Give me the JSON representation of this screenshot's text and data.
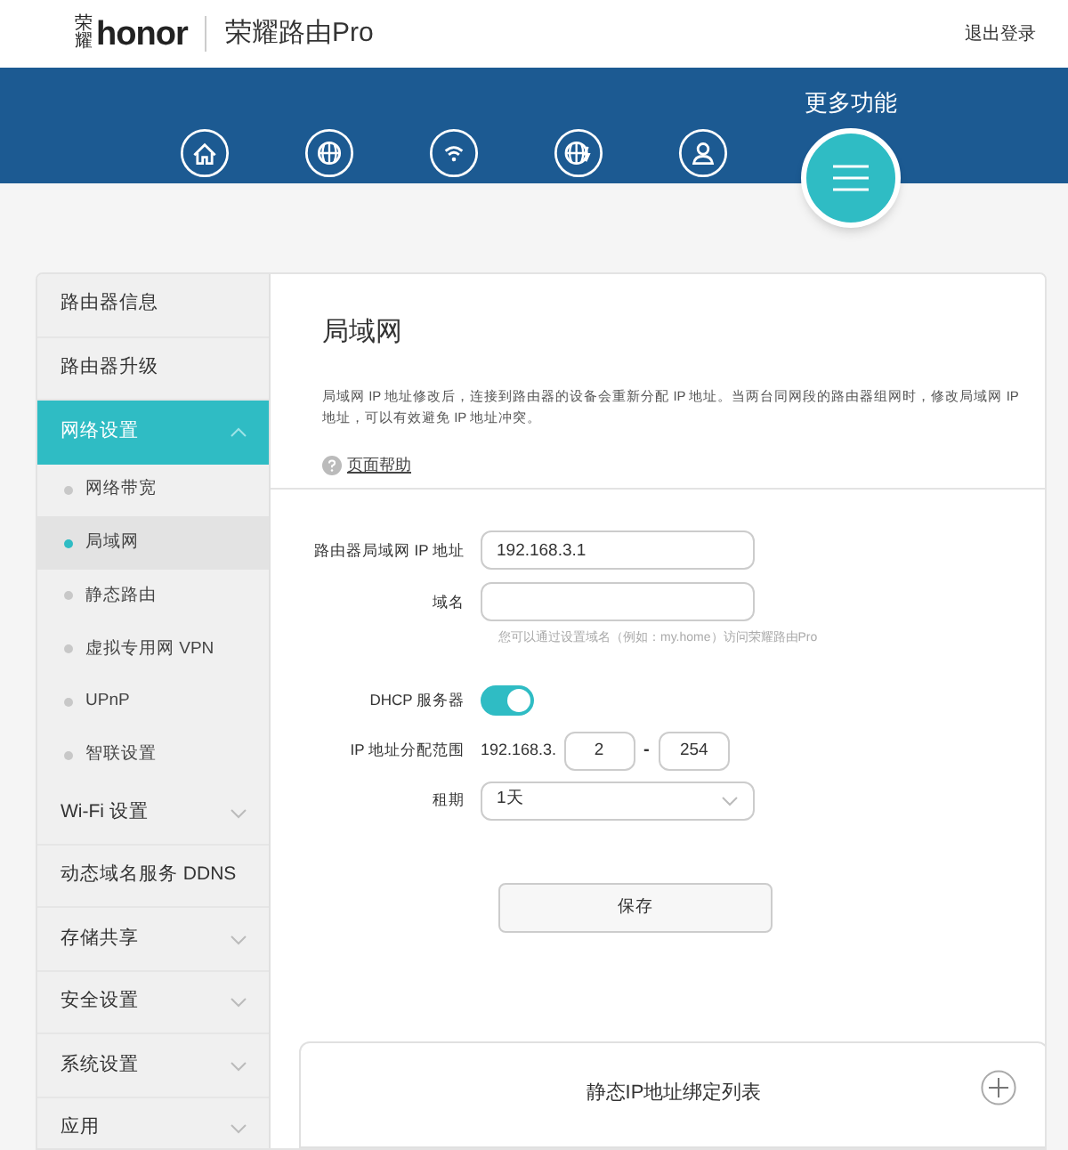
{
  "header": {
    "logo_mark": "荣耀",
    "logo": "honor",
    "product": "荣耀路由Pro",
    "logout": "退出登录"
  },
  "nav": {
    "icons": [
      {
        "kind": "home"
      },
      {
        "kind": "globe"
      },
      {
        "kind": "wifi"
      },
      {
        "kind": "globe-bolt"
      },
      {
        "kind": "user"
      }
    ],
    "more_label": "更多功能"
  },
  "sidebar": {
    "items": [
      {
        "label": "路由器信息",
        "selected": false,
        "expandable": false
      },
      {
        "label": "路由器升级",
        "selected": false,
        "expandable": false
      },
      {
        "label": "网络设置",
        "selected": true,
        "expandable": true,
        "expanded": true,
        "children": [
          {
            "label": "网络带宽",
            "selected": false
          },
          {
            "label": "局域网",
            "selected": true
          },
          {
            "label": "静态路由",
            "selected": false
          },
          {
            "label": "虚拟专用网 VPN",
            "selected": false
          },
          {
            "label": "UPnP",
            "selected": false
          },
          {
            "label": "智联设置",
            "selected": false
          }
        ]
      },
      {
        "label": "Wi-Fi 设置",
        "selected": false,
        "expandable": true,
        "expanded": false
      },
      {
        "label": "动态域名服务 DDNS",
        "selected": false,
        "expandable": false
      },
      {
        "label": "存储共享",
        "selected": false,
        "expandable": true,
        "expanded": false
      },
      {
        "label": "安全设置",
        "selected": false,
        "expandable": true,
        "expanded": false
      },
      {
        "label": "系统设置",
        "selected": false,
        "expandable": true,
        "expanded": false
      },
      {
        "label": "应用",
        "selected": false,
        "expandable": true,
        "expanded": false
      }
    ]
  },
  "content": {
    "title": "局域网",
    "description": "局域网 IP 地址修改后，连接到路由器的设备会重新分配 IP 地址。当两台同网段的路由器组网时，修改局域网 IP 地址，可以有效避免 IP 地址冲突。",
    "help_link": "页面帮助",
    "form": {
      "ip_label": "路由器局域网 IP 地址",
      "ip_value": "192.168.3.1",
      "domain_label": "域名",
      "domain_hint": "您可以通过设置域名（例如：my.home）访问荣耀路由Pro",
      "dhcp_label": "DHCP 服务器",
      "dhcp_on": true,
      "range_label": "IP 地址分配范围",
      "range_prefix": "192.168.3.",
      "range_start": "2",
      "range_separator": "-",
      "range_end": "254",
      "lease_label": "租期",
      "lease_value": "1天",
      "save": "保存"
    },
    "static_list": {
      "title": "静态IP地址绑定列表"
    }
  }
}
